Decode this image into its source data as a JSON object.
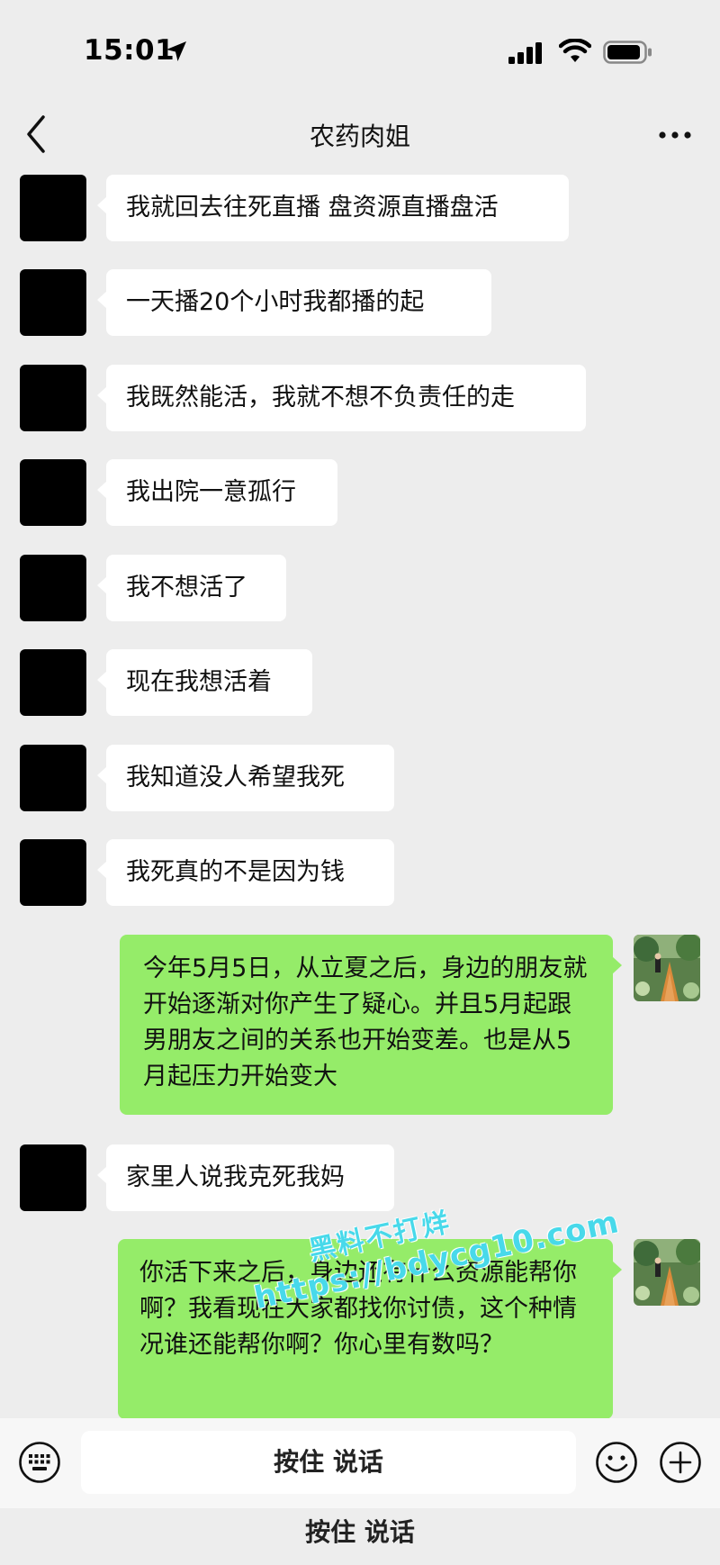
{
  "status_bar": {
    "time": "15:01"
  },
  "nav": {
    "title": "农药肉姐"
  },
  "messages": [
    {
      "side": "in",
      "text": "我就回去往死直播 盘资源直播盘活"
    },
    {
      "side": "in",
      "text": "一天播20个小时我都播的起"
    },
    {
      "side": "in",
      "text": "我既然能活，我就不想不负责任的走"
    },
    {
      "side": "in",
      "text": "我出院一意孤行"
    },
    {
      "side": "in",
      "text": "我不想活了"
    },
    {
      "side": "in",
      "text": "现在我想活着"
    },
    {
      "side": "in",
      "text": "我知道没人希望我死"
    },
    {
      "side": "in",
      "text": "我死真的不是因为钱"
    },
    {
      "side": "out",
      "text": "今年5月5日，从立夏之后，身边的朋友就开始逐渐对你产生了疑心。并且5月起跟男朋友之间的关系也开始变差。也是从5月起压力开始变大"
    },
    {
      "side": "in",
      "text": "家里人说我克死我妈"
    },
    {
      "side": "out",
      "text": "你活下来之后，身边还有什么资源能帮你啊？我看现在大家都找你讨债，这个种情况谁还能帮你啊？你心里有数吗？"
    }
  ],
  "watermark": {
    "line1": "黑料不打烊",
    "line2": "https://bdycg10.com"
  },
  "input_bar": {
    "hold_to_talk": "按住 说话"
  },
  "bottom_caption": "按住 说话",
  "colors": {
    "background": "#ededed",
    "incoming_bubble": "#ffffff",
    "outgoing_bubble": "#95ec69",
    "watermark": "#28d2e6"
  },
  "icons": {
    "location": "location-arrow-icon",
    "signal": "cellular-signal-icon",
    "wifi": "wifi-icon",
    "battery": "battery-icon",
    "back": "chevron-left-icon",
    "more": "more-dots-icon",
    "voice": "keyboard-icon",
    "emoji": "emoji-icon",
    "plus": "plus-icon"
  }
}
